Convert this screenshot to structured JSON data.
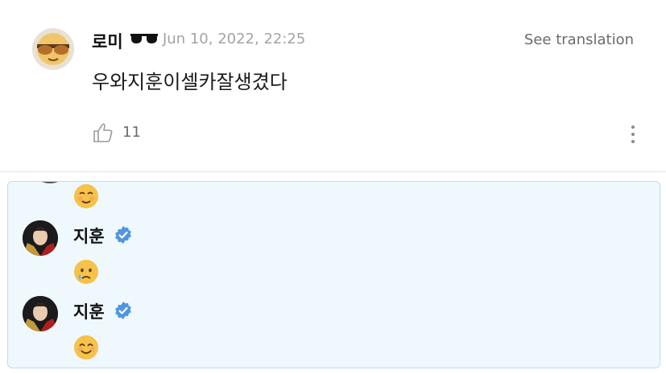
{
  "comment": {
    "author": "로미",
    "timestamp": "Jun 10, 2022, 22:25",
    "see_translation": "See translation",
    "text": "우와지훈이셀카잘생겼다",
    "like_count": "11"
  },
  "replies": [
    {
      "author": "지훈",
      "emoji": "crying-face"
    },
    {
      "author": "지훈",
      "emoji": "smiling-face"
    }
  ],
  "colors": {
    "panel_bg": "#eef8fd",
    "panel_border": "#b9dff0",
    "verified_blue": "#4f95e3",
    "muted_text": "#a3a3a3"
  }
}
